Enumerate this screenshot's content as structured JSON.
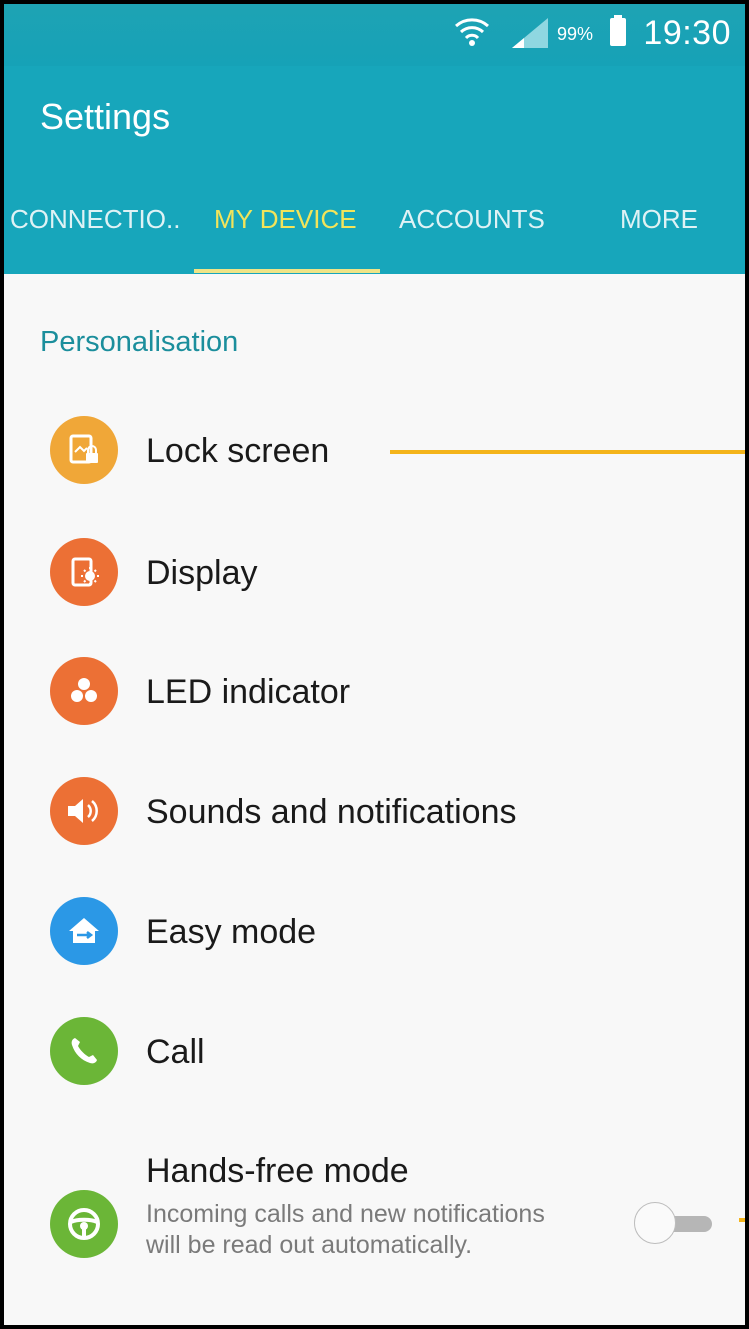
{
  "status_bar": {
    "battery_percent": "99%",
    "time": "19:30"
  },
  "app_bar": {
    "title": "Settings"
  },
  "tabs": [
    {
      "label": "CONNECTIO.."
    },
    {
      "label": "MY DEVICE",
      "active": true
    },
    {
      "label": "ACCOUNTS"
    },
    {
      "label": "MORE"
    }
  ],
  "section": {
    "title": "Personalisation"
  },
  "items": [
    {
      "label": "Lock screen",
      "icon": "lock-screen-icon",
      "color": "#f0a738"
    },
    {
      "label": "Display",
      "icon": "display-icon",
      "color": "#ec7035"
    },
    {
      "label": "LED indicator",
      "icon": "led-indicator-icon",
      "color": "#ec7035"
    },
    {
      "label": "Sounds and notifications",
      "icon": "speaker-icon",
      "color": "#ec7035"
    },
    {
      "label": "Easy mode",
      "icon": "easy-mode-home-icon",
      "color": "#2b98e6"
    },
    {
      "label": "Call",
      "icon": "phone-icon",
      "color": "#6bb637"
    },
    {
      "label": "Hands-free mode",
      "icon": "steering-wheel-icon",
      "color": "#6bb637",
      "subtitle": "Incoming calls and new notifications will be read out automatically.",
      "toggle_on": false
    }
  ],
  "colors": {
    "app_bar": "#17a6bb",
    "tab_active": "#f2e45a",
    "section_header": "#1b8e9c",
    "annotation": "#f4b41a"
  }
}
